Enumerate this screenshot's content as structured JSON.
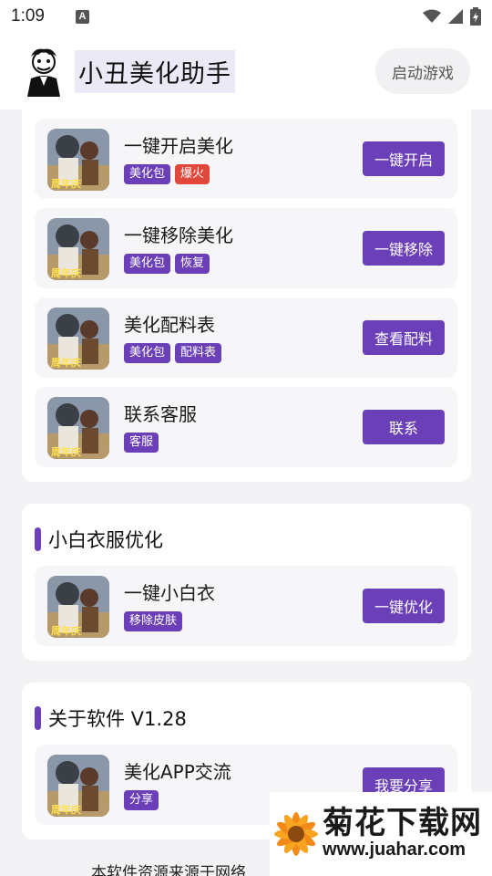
{
  "status_bar": {
    "time": "1:09",
    "notification_letter": "A"
  },
  "header": {
    "title": "小丑美化助手",
    "start_button": "启动游戏"
  },
  "section_main": {
    "items": [
      {
        "title": "一键开启美化",
        "tags": [
          "美化包",
          "爆火"
        ],
        "button": "一键开启"
      },
      {
        "title": "一键移除美化",
        "tags": [
          "美化包",
          "恢复"
        ],
        "button": "一键移除"
      },
      {
        "title": "美化配料表",
        "tags": [
          "美化包",
          "配料表"
        ],
        "button": "查看配料"
      },
      {
        "title": "联系客服",
        "tags": [
          "客服"
        ],
        "button": "联系"
      }
    ]
  },
  "section_white": {
    "title": "小白衣服优化",
    "items": [
      {
        "title": "一键小白衣",
        "tags": [
          "移除皮肤"
        ],
        "button": "一键优化"
      }
    ]
  },
  "section_about": {
    "title": "关于软件 V1.28",
    "items": [
      {
        "title": "美化APP交流",
        "tags": [
          "分享"
        ],
        "button": "我要分享"
      }
    ]
  },
  "footer": {
    "text": "本软件资源来源于网络"
  },
  "watermark": {
    "title": "菊花下载网",
    "url": "www.juahar.com"
  },
  "colors": {
    "accent": "#6a3fb8",
    "hot_tag": "#e2473b",
    "background": "#f3f3f5"
  },
  "icons": [
    "wifi-icon",
    "signal-icon",
    "battery-icon",
    "joker-logo-icon",
    "game-thumbnail-icon"
  ]
}
